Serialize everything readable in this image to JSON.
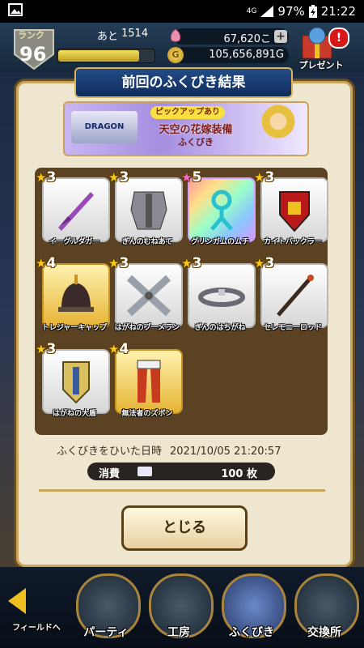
{
  "status": {
    "signal": "4G",
    "battery": "97%",
    "time": "21:22"
  },
  "header": {
    "rank_label": "ランク",
    "rank_value": "96",
    "stamina_prefix": "あと",
    "stamina_value": "1514",
    "exp_fraction": 0.85,
    "gems": "67,620こ",
    "gold": "105,656,891G",
    "gold_icon": "G",
    "present_label": "プレゼント",
    "present_badge": "!"
  },
  "dialog": {
    "title": "前回のふくびき結果",
    "banner": {
      "logo": "DRAGON QUEST V",
      "pickup": "ピックアップあり",
      "main": "天空の花嫁装備",
      "sub": "ふくびき"
    },
    "items": [
      {
        "stars": "3",
        "name": "イーグルダガー",
        "frame": "silver",
        "icon": "dagger-icon"
      },
      {
        "stars": "3",
        "name": "ぎんのむねあて",
        "frame": "silver",
        "icon": "silver-breastplate-icon"
      },
      {
        "stars": "5",
        "name": "グリンガムのムチ",
        "frame": "rainbow",
        "icon": "whip-icon"
      },
      {
        "stars": "3",
        "name": "カイトバックラー",
        "frame": "silver",
        "icon": "kite-shield-icon"
      },
      {
        "stars": "4",
        "name": "トレジャーキャップ",
        "frame": "gold",
        "icon": "treasure-cap-icon"
      },
      {
        "stars": "3",
        "name": "はがねのブーメラン",
        "frame": "silver",
        "icon": "boomerang-icon"
      },
      {
        "stars": "3",
        "name": "ぎんのはちがね",
        "frame": "silver",
        "icon": "headband-icon"
      },
      {
        "stars": "3",
        "name": "セレモニーロッド",
        "frame": "silver",
        "icon": "rod-icon"
      },
      {
        "stars": "3",
        "name": "はがねの大盾",
        "frame": "silver",
        "icon": "great-shield-icon"
      },
      {
        "stars": "4",
        "name": "無法者のズボン",
        "frame": "gold",
        "icon": "pants-icon"
      }
    ],
    "date_label": "ふくびきをひいた日時",
    "date_value": "2021/10/05 21:20:57",
    "cost_label": "消費",
    "cost_value": "100 枚",
    "close_label": "とじる"
  },
  "nav": {
    "items": [
      {
        "label": "フィールドへ",
        "icon": "field-arrow-icon"
      },
      {
        "label": "パーティ",
        "icon": "party-icon"
      },
      {
        "label": "工房",
        "icon": "workshop-hammer-icon"
      },
      {
        "label": "ふくびき",
        "icon": "lottery-chest-icon"
      },
      {
        "label": "交換所",
        "icon": "exchange-scale-icon"
      }
    ]
  }
}
